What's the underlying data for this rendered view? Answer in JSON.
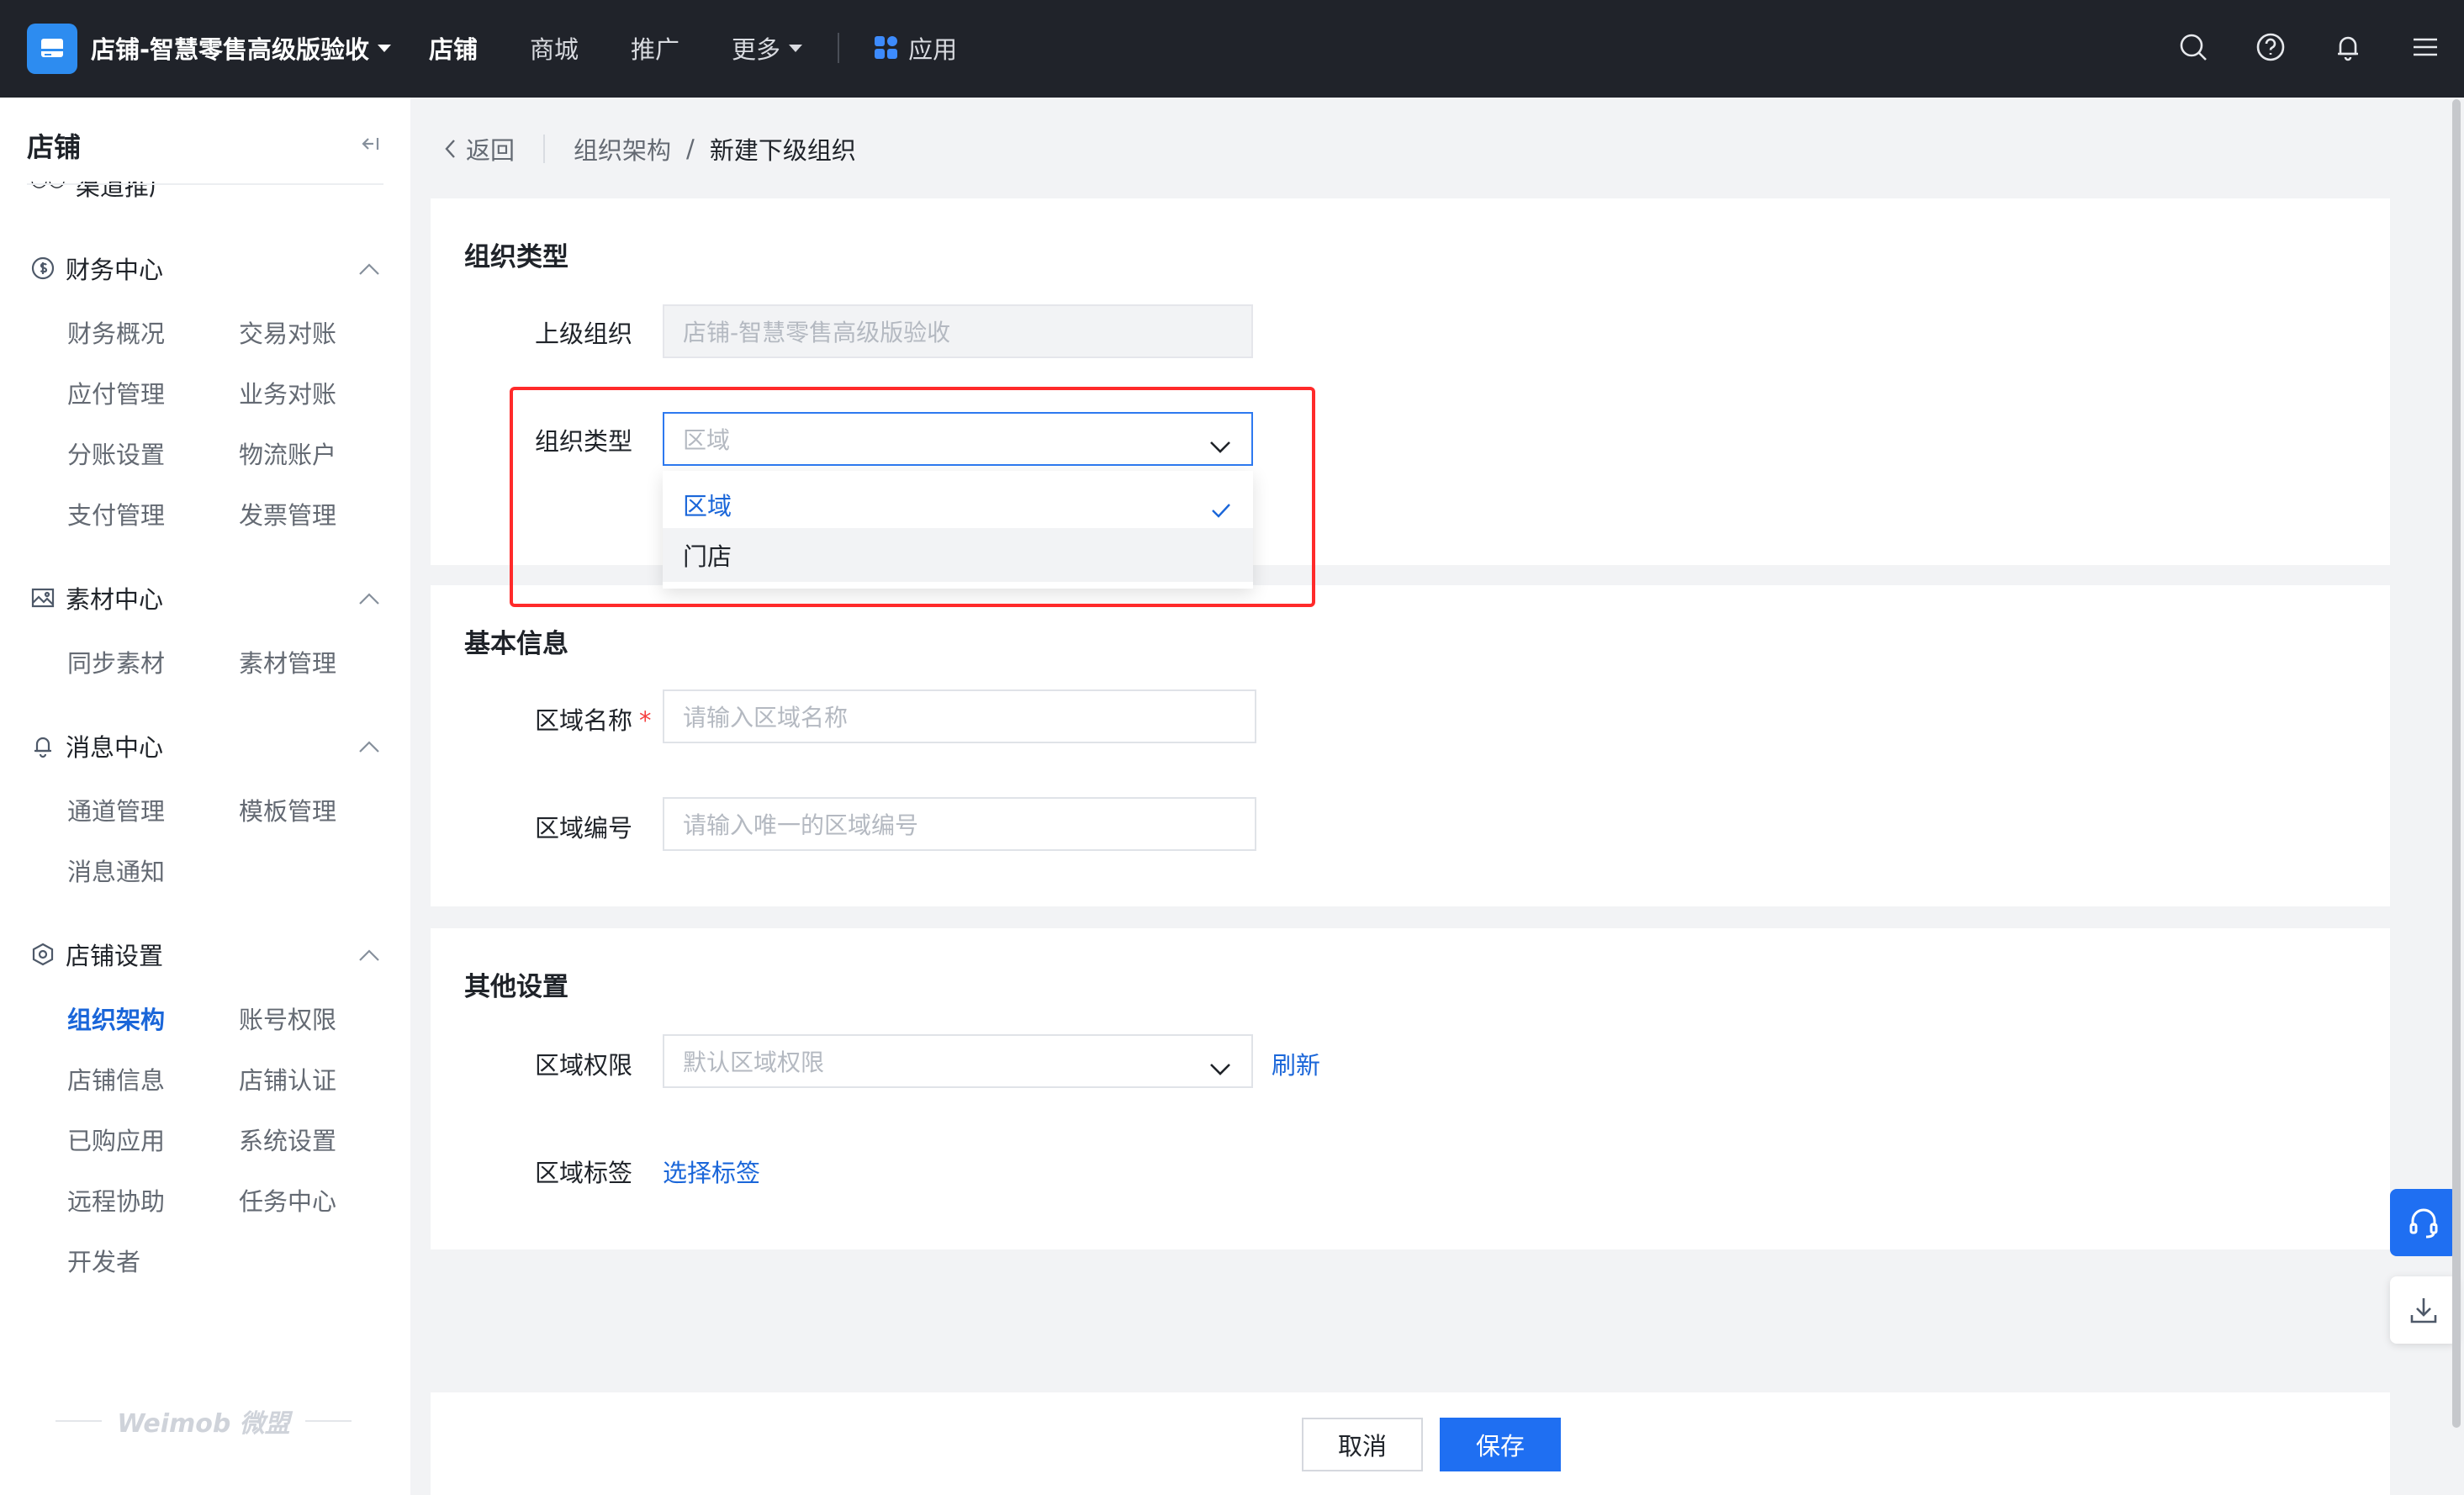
{
  "header": {
    "shop_name": "店铺-智慧零售高级版验收",
    "nav": {
      "store": "店铺",
      "mall": "商城",
      "promotion": "推广",
      "more": "更多",
      "apps": "应用"
    }
  },
  "sidebar": {
    "title": "店铺",
    "partial_item": "渠道推广",
    "groups": {
      "finance": {
        "title": "财务中心",
        "items": [
          "财务概况",
          "交易对账",
          "应付管理",
          "业务对账",
          "分账设置",
          "物流账户",
          "支付管理",
          "发票管理"
        ]
      },
      "material": {
        "title": "素材中心",
        "items": [
          "同步素材",
          "素材管理"
        ]
      },
      "message": {
        "title": "消息中心",
        "items": [
          "通道管理",
          "模板管理",
          "消息通知"
        ]
      },
      "settings": {
        "title": "店铺设置",
        "items": [
          "组织架构",
          "账号权限",
          "店铺信息",
          "店铺认证",
          "已购应用",
          "系统设置",
          "远程协助",
          "任务中心",
          "开发者"
        ],
        "active": "组织架构"
      }
    },
    "brand": "Weimob 微盟"
  },
  "breadcrumb": {
    "back": "返回",
    "parent": "组织架构",
    "current": "新建下级组织"
  },
  "org_type_section": {
    "title": "组织类型",
    "parent_label": "上级组织",
    "parent_value": "店铺-智慧零售高级版验收",
    "type_label": "组织类型",
    "type_value": "区域",
    "options": [
      "区域",
      "门店"
    ],
    "selected": "区域"
  },
  "basic_info": {
    "title": "基本信息",
    "name_label": "区域名称",
    "required_mark": "*",
    "name_placeholder": "请输入区域名称",
    "code_label": "区域编号",
    "code_placeholder": "请输入唯一的区域编号"
  },
  "other_settings": {
    "title": "其他设置",
    "permission_label": "区域权限",
    "permission_placeholder": "默认区域权限",
    "refresh": "刷新",
    "tag_label": "区域标签",
    "select_tag": "选择标签"
  },
  "footer": {
    "cancel": "取消",
    "save": "保存"
  },
  "colors": {
    "primary": "#1f6ff2",
    "link": "#1a66d9",
    "highlight": "#ff2a2a",
    "topbar": "#20232a"
  }
}
